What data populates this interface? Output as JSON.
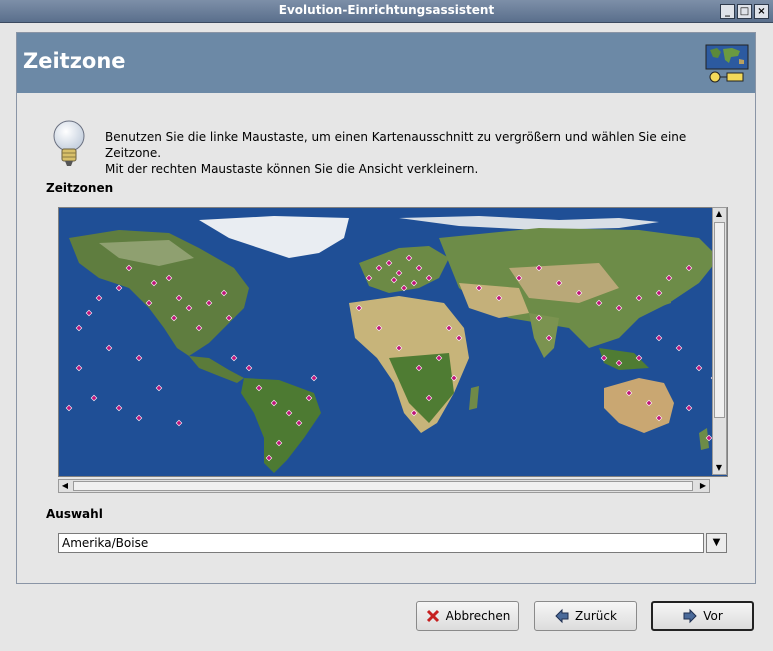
{
  "window": {
    "title": "Evolution-Einrichtungsassistent",
    "controls": [
      "minimize",
      "maximize",
      "close"
    ]
  },
  "header": {
    "title": "Zeitzone",
    "icon": "world-map-clock-icon"
  },
  "intro": {
    "line1": "Benutzen Sie die linke Maustaste, um einen Kartenausschnitt zu vergrößern und wählen Sie eine Zeitzone.",
    "line2": "Mit der rechten Maustaste können Sie die Ansicht verkleinern."
  },
  "timezones_label": "Zeitzonen",
  "selection": {
    "label": "Auswahl",
    "value": "Amerika/Boise"
  },
  "buttons": {
    "cancel": "Abbrechen",
    "back": "Zurück",
    "forward": "Vor"
  },
  "colors": {
    "header_bg": "#6c89a6",
    "ocean": "#1f4f96",
    "marker": "#c0147a"
  }
}
